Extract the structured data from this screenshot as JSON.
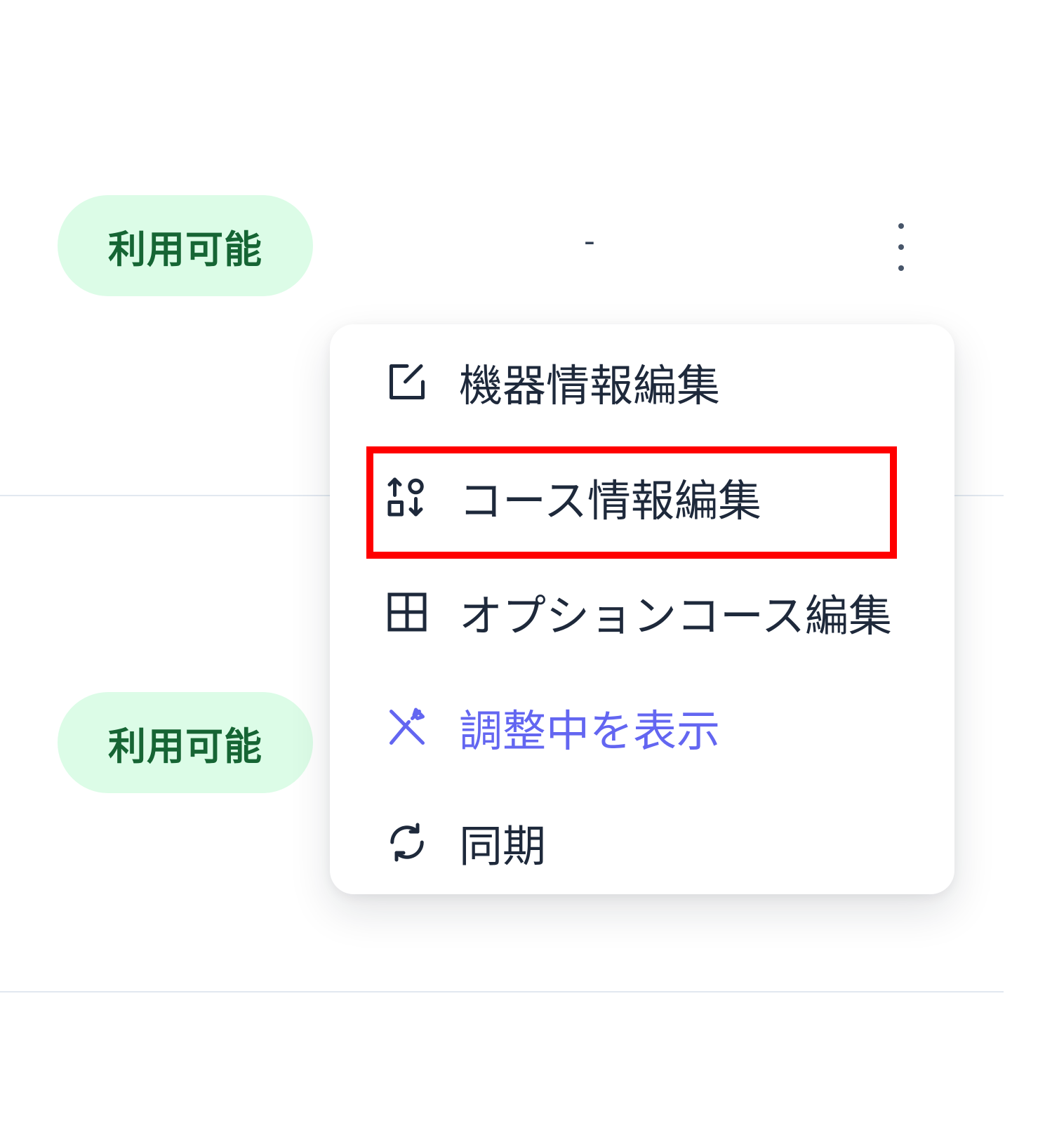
{
  "rows": [
    {
      "status": "利用可能",
      "value": "-"
    },
    {
      "status": "利用可能"
    }
  ],
  "menu": {
    "items": [
      {
        "label": "機器情報編集",
        "icon": "edit-square-icon"
      },
      {
        "label": "コース情報編集",
        "icon": "sort-shapes-icon"
      },
      {
        "label": "オプションコース編集",
        "icon": "grid-layout-icon"
      },
      {
        "label": "調整中を表示",
        "icon": "tools-icon"
      },
      {
        "label": "同期",
        "icon": "sync-icon"
      }
    ]
  },
  "colors": {
    "badge_bg": "#dcfce7",
    "badge_text": "#166534",
    "accent": "#6366f1",
    "text": "#1e293b",
    "divider": "#e2e8f0",
    "highlight": "#ff0000"
  }
}
